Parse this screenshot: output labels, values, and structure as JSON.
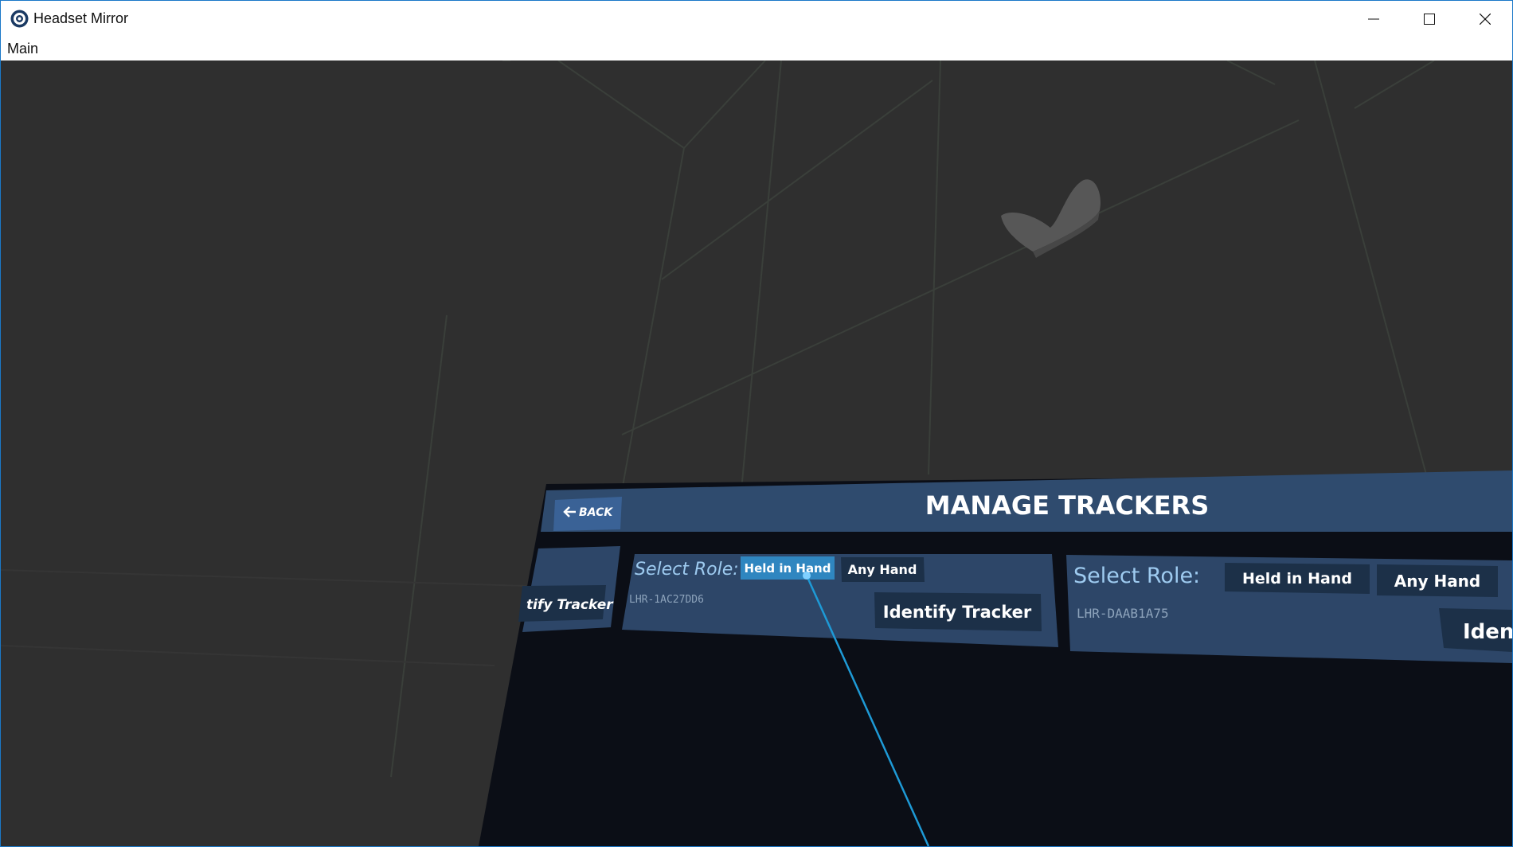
{
  "window": {
    "title": "Headset Mirror"
  },
  "menu": {
    "items": [
      "Main"
    ]
  },
  "vr_panel": {
    "back_label": "BACK",
    "heading": "MANAGE TRACKERS",
    "cards": [
      {
        "identify_label": "tify Tracker"
      },
      {
        "select_role_label": "Select Role:",
        "role_options": [
          "Held in Hand",
          "Any Hand"
        ],
        "selected_role": "Held in Hand",
        "serial": "LHR-1AC27DD6",
        "identify_label": "Identify Tracker"
      },
      {
        "select_role_label": "Select Role:",
        "role_options": [
          "Held in Hand",
          "Any Hand"
        ],
        "serial": "LHR-DAAB1A75",
        "identify_label": "Iden"
      }
    ]
  },
  "colors": {
    "panel_header": "#2f4b6e",
    "card_bg": "#2d4668",
    "button_bg": "#1c3048",
    "selected_button": "#2f86c0",
    "pointer_beam": "#1e9ad6",
    "scene_bg": "#2f2f2f"
  }
}
